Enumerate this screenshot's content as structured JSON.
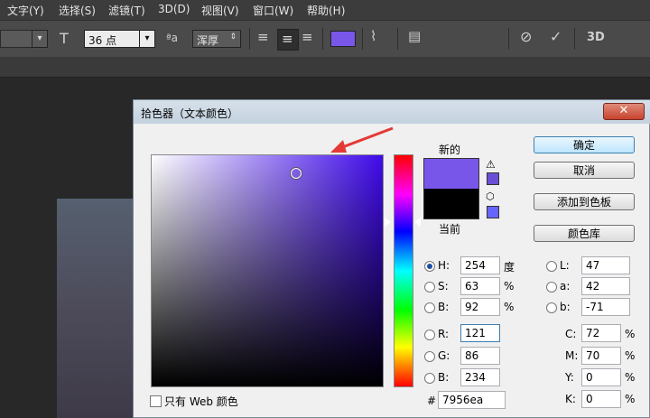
{
  "menubar": {
    "items": [
      "文字(Y)",
      "选择(S)",
      "滤镜(T)",
      "3D(D)",
      "视图(V)",
      "窗口(W)",
      "帮助(H)"
    ]
  },
  "options": {
    "font_size": "36 点",
    "aa_label": "ªa",
    "antialias": "浑厚",
    "color": "#7956ea",
    "threed": "3D"
  },
  "dialog": {
    "title": "拾色器（文本颜色）",
    "new_label": "新的",
    "current_label": "当前",
    "new_color": "#7956ea",
    "current_color": "#000000",
    "buttons": {
      "ok": "确定",
      "cancel": "取消",
      "add_swatch": "添加到色板",
      "libraries": "颜色库"
    },
    "hsb": {
      "H": {
        "label": "H:",
        "value": "254",
        "unit": "度"
      },
      "S": {
        "label": "S:",
        "value": "63",
        "unit": "%"
      },
      "B": {
        "label": "B:",
        "value": "92",
        "unit": "%"
      }
    },
    "rgb": {
      "R": {
        "label": "R:",
        "value": "121"
      },
      "G": {
        "label": "G:",
        "value": "86"
      },
      "B": {
        "label": "B:",
        "value": "234"
      }
    },
    "lab": {
      "L": {
        "label": "L:",
        "value": "47"
      },
      "a": {
        "label": "a:",
        "value": "42"
      },
      "b": {
        "label": "b:",
        "value": "-71"
      }
    },
    "cmyk": {
      "C": {
        "label": "C:",
        "value": "72",
        "unit": "%"
      },
      "M": {
        "label": "M:",
        "value": "70",
        "unit": "%"
      },
      "Y": {
        "label": "Y:",
        "value": "0",
        "unit": "%"
      },
      "K": {
        "label": "K:",
        "value": "0",
        "unit": "%"
      }
    },
    "hex_label": "#",
    "hex": "7956ea",
    "web_only": "只有 Web 颜色",
    "selected_mode": "H"
  }
}
